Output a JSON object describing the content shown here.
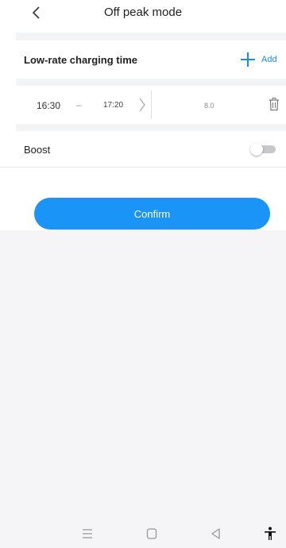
{
  "header": {
    "title": "Off peak mode",
    "back_icon": "chevron-left-icon"
  },
  "charging_section": {
    "title": "Low-rate charging time",
    "add_label": "Add",
    "add_icon": "plus-icon"
  },
  "time_slots": [
    {
      "start": "16:30",
      "separator": "–",
      "end": "17:20",
      "power": "8.0",
      "chevron_icon": "chevron-right-icon",
      "delete_icon": "trash-icon"
    }
  ],
  "boost": {
    "label": "Boost",
    "enabled": false
  },
  "confirm_label": "Confirm",
  "system_nav": {
    "icons": [
      "menu-icon",
      "home-square-icon",
      "back-triangle-icon",
      "accessibility-icon"
    ]
  },
  "colors": {
    "accent": "#1a94f6",
    "link": "#1a8cf0",
    "page_bg": "#f5f5f7",
    "card_bg": "#ffffff"
  }
}
